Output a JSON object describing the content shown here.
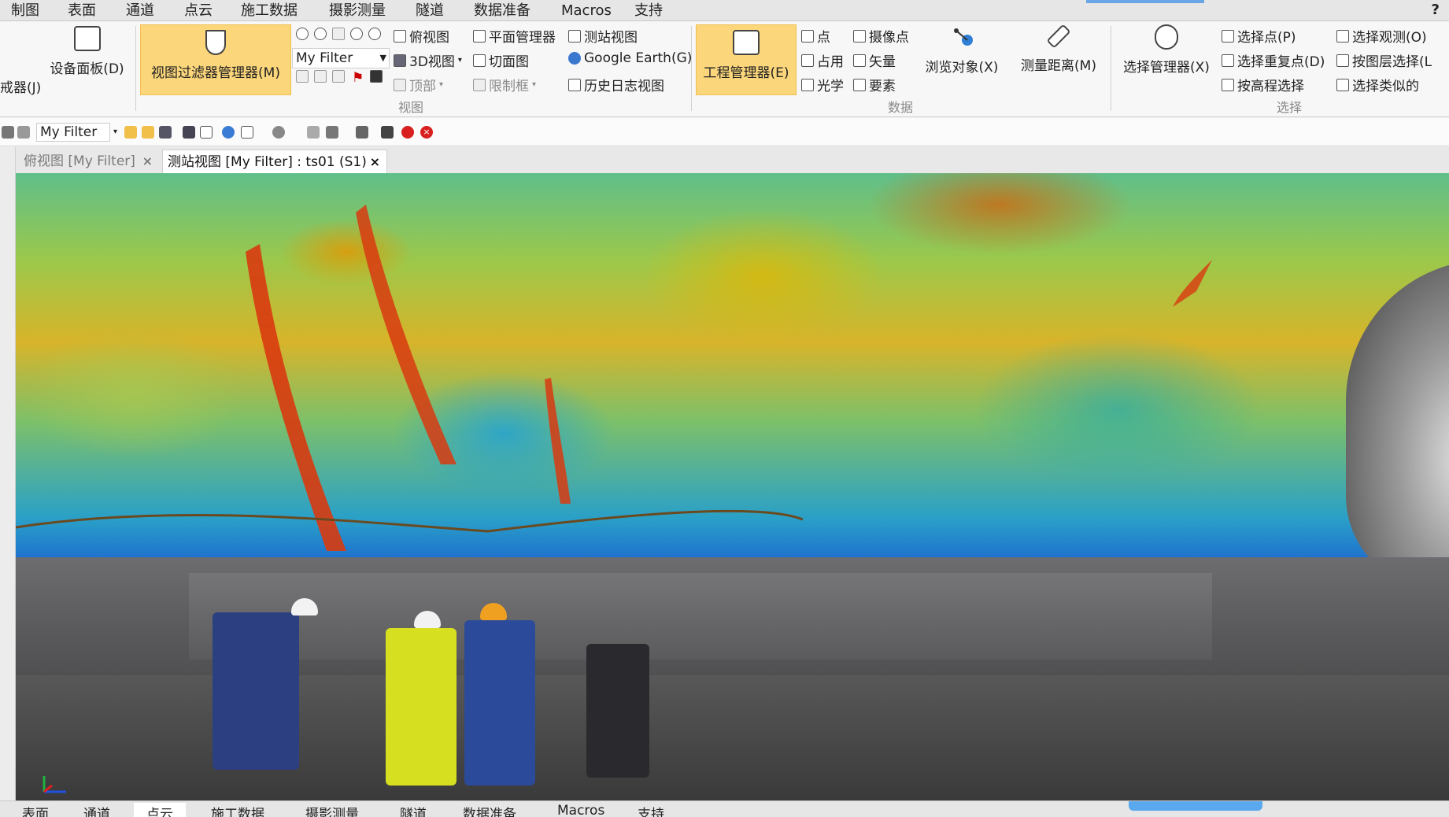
{
  "menu": {
    "tabs": [
      "制图",
      "表面",
      "通道",
      "点云",
      "施工数据",
      "摄影测量",
      "隧道",
      "数据准备",
      "Macros",
      "支持"
    ],
    "help": "?"
  },
  "ribbon": {
    "partial_left": "戒器(J)",
    "device_panel": "设备面板(D)",
    "view_filter_manager": "视图过滤器管理器(M)",
    "filter_combo": "My Filter",
    "view_items": {
      "top_view": "俯视图",
      "view3d": "3D视图",
      "top": "顶部",
      "plane_manager": "平面管理器",
      "section": "切面图",
      "limit_box": "限制框",
      "station_view": "测站视图",
      "google_earth": "Google Earth(G)",
      "history_view": "历史日志视图"
    },
    "view_group": "视图",
    "project_manager": "工程管理器(E)",
    "data_items": {
      "point": "点",
      "occupy": "占用",
      "optics": "光学",
      "camera_point": "摄像点",
      "vector": "矢量",
      "feature": "要素"
    },
    "browse_object": "浏览对象(X)",
    "measure_distance": "测量距离(M)",
    "data_group": "数据",
    "select_manager": "选择管理器(X)",
    "select_items": {
      "select_point": "选择点(P)",
      "select_repeat": "选择重复点(D)",
      "by_elevation": "按高程选择",
      "select_observation": "选择观测(O)",
      "by_layer": "按图层选择(L",
      "select_similar": "选择类似的"
    },
    "select_group": "选择"
  },
  "toolbar": {
    "filter_combo": "My Filter"
  },
  "doc_tabs": [
    {
      "label": "俯视图 [My Filter]",
      "close": "×"
    },
    {
      "label": "测站视图 [My Filter] : ts01 (S1)",
      "close": "×"
    }
  ],
  "bottom": {
    "tabs": [
      "表面",
      "通道",
      "点云",
      "施工数据",
      "摄影测量",
      "隧道",
      "数据准备",
      "Macros",
      "支持"
    ]
  }
}
